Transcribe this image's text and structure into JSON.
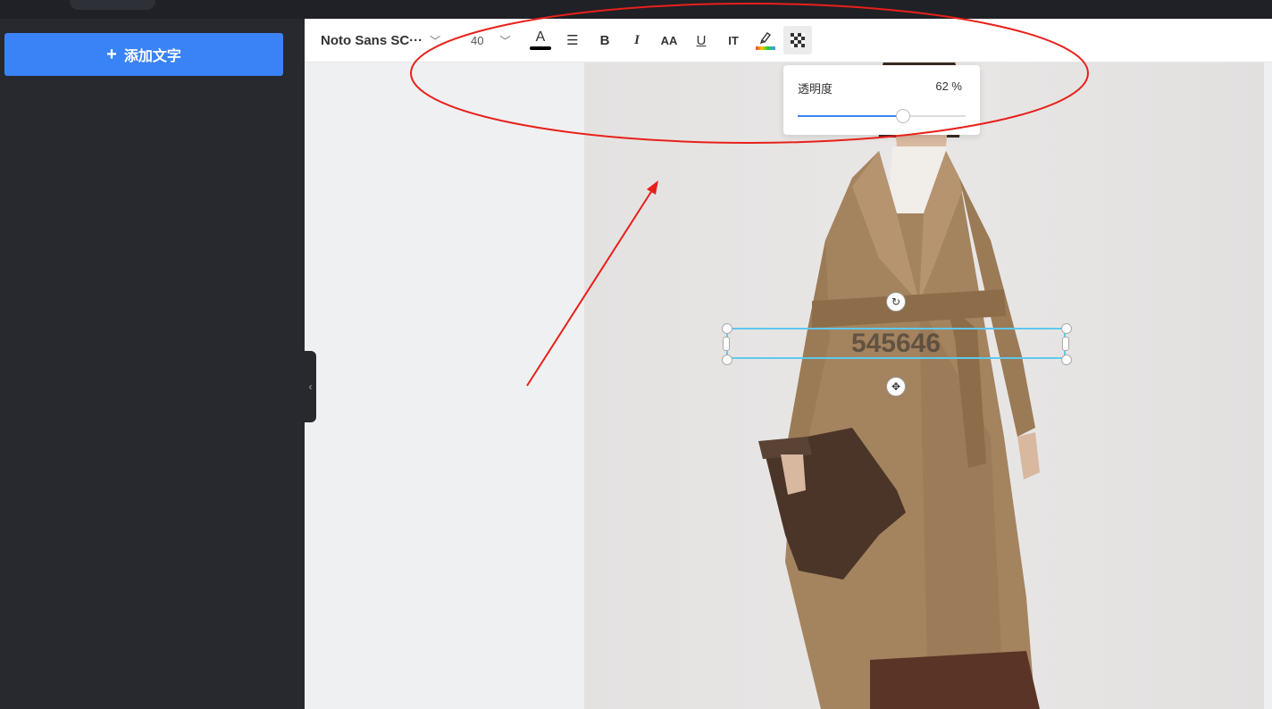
{
  "sidebar": {
    "add_text_label": "添加文字",
    "plus_icon": "+"
  },
  "collapse": {
    "icon": "‹"
  },
  "toolbar": {
    "font_family": "Noto Sans SC···",
    "font_size": "40",
    "chevron": "﹀",
    "text_color": "#000000",
    "color_glyph": "A",
    "align_glyph": "☰",
    "bold_glyph": "B",
    "italic_glyph": "I",
    "spacing_glyph": "AA",
    "underline_glyph": "U",
    "lineheight_glyph": "IT"
  },
  "opacity": {
    "label": "透明度",
    "value_text": "62 %",
    "value": 62
  },
  "canvas": {
    "text": "545646",
    "rotate_icon": "↻",
    "move_icon": "✥"
  },
  "annotation": {
    "color": "#e8201a"
  }
}
